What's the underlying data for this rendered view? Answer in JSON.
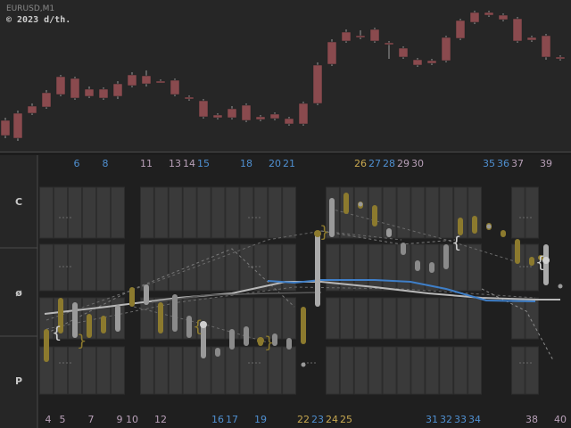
{
  "header": {
    "symbol": "EURUSD,M1",
    "copyright": "© 2023 d/th."
  },
  "rows": {
    "top_label": "C",
    "mid_label": "ø",
    "bot_label": "P"
  },
  "top_numbers": [
    {
      "t": "6",
      "c": "#4f8fd0"
    },
    {
      "t": "8",
      "c": "#4f8fd0"
    },
    {
      "t": "11",
      "c": "#b8a0b8"
    },
    {
      "t": "13",
      "c": "#b8a0b8"
    },
    {
      "t": "14",
      "c": "#b8a0b8"
    },
    {
      "t": "15",
      "c": "#4f8fd0"
    },
    {
      "t": "18",
      "c": "#4f8fd0"
    },
    {
      "t": "20",
      "c": "#4f8fd0"
    },
    {
      "t": "21",
      "c": "#4f8fd0"
    },
    {
      "t": "26",
      "c": "#c8a850"
    },
    {
      "t": "27",
      "c": "#4f8fd0"
    },
    {
      "t": "28",
      "c": "#4f8fd0"
    },
    {
      "t": "29",
      "c": "#b8a0b8"
    },
    {
      "t": "30",
      "c": "#b8a0b8"
    },
    {
      "t": "35",
      "c": "#4f8fd0"
    },
    {
      "t": "36",
      "c": "#4f8fd0"
    },
    {
      "t": "37",
      "c": "#b8a0b8"
    },
    {
      "t": "39",
      "c": "#b8a0b8"
    }
  ],
  "bottom_numbers": [
    {
      "t": "4",
      "c": "#b8a0b8"
    },
    {
      "t": "5",
      "c": "#b8a0b8"
    },
    {
      "t": "7",
      "c": "#b8a0b8"
    },
    {
      "t": "9",
      "c": "#b8a0b8"
    },
    {
      "t": "10",
      "c": "#b8a0b8"
    },
    {
      "t": "12",
      "c": "#b8a0b8"
    },
    {
      "t": "16",
      "c": "#4f8fd0"
    },
    {
      "t": "17",
      "c": "#4f8fd0"
    },
    {
      "t": "19",
      "c": "#4f8fd0"
    },
    {
      "t": "22",
      "c": "#c8a850"
    },
    {
      "t": "23",
      "c": "#4f8fd0"
    },
    {
      "t": "24",
      "c": "#c8a850"
    },
    {
      "t": "25",
      "c": "#c8a850"
    },
    {
      "t": "31",
      "c": "#4f8fd0"
    },
    {
      "t": "32",
      "c": "#4f8fd0"
    },
    {
      "t": "33",
      "c": "#4f8fd0"
    },
    {
      "t": "34",
      "c": "#4f8fd0"
    },
    {
      "t": "38",
      "c": "#b8a0b8"
    },
    {
      "t": "40",
      "c": "#b8a0b8"
    }
  ],
  "colors": {
    "bull": "#4f8a4f",
    "bear": "#8a4a4e",
    "gold": "#8c7a2e",
    "grey": "#8a8a8a",
    "blue": "#3f7fc8"
  }
}
